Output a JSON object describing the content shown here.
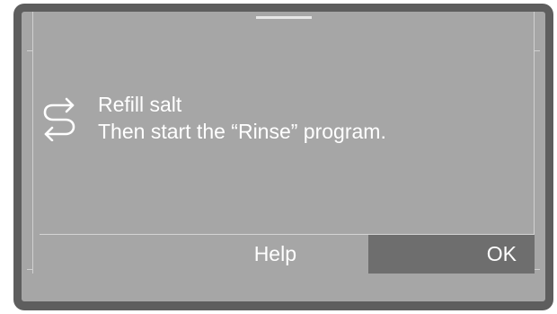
{
  "message": {
    "line1": "Refill salt",
    "line2": "Then start the “Rinse” program.",
    "icon": "rinse-arrows-icon"
  },
  "buttons": {
    "help_label": "Help",
    "ok_label": "OK"
  },
  "colors": {
    "bezel": "#5e5e5e",
    "screen": "#a6a6a6",
    "selected_button": "#6e6e6e",
    "text": "#ffffff"
  }
}
